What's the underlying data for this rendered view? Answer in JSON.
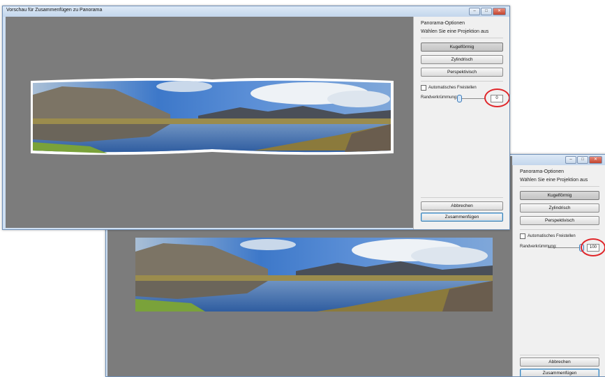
{
  "window": {
    "title": "Vorschau für Zusammenfügen zu Panorama",
    "minimize_glyph": "–",
    "maximize_glyph": "□",
    "close_glyph": "✕"
  },
  "panel": {
    "title": "Panorama-Optionen",
    "subtitle": "Wählen Sie eine Projektion aus",
    "projections": [
      "Kugelförmig",
      "Zylindrisch",
      "Perspektivisch"
    ],
    "auto_crop_label": "Automatisches Freistellen",
    "boundary_label": "Randverkrümmung:",
    "cancel_label": "Abbrechen",
    "merge_label": "Zusammenfügen"
  },
  "front": {
    "boundary_value": "0",
    "slider_fraction": 0.0
  },
  "back": {
    "boundary_value": "100",
    "slider_fraction": 1.0
  },
  "colors": {
    "highlight": "#e0262a",
    "canvas": "#7c7c7c"
  }
}
